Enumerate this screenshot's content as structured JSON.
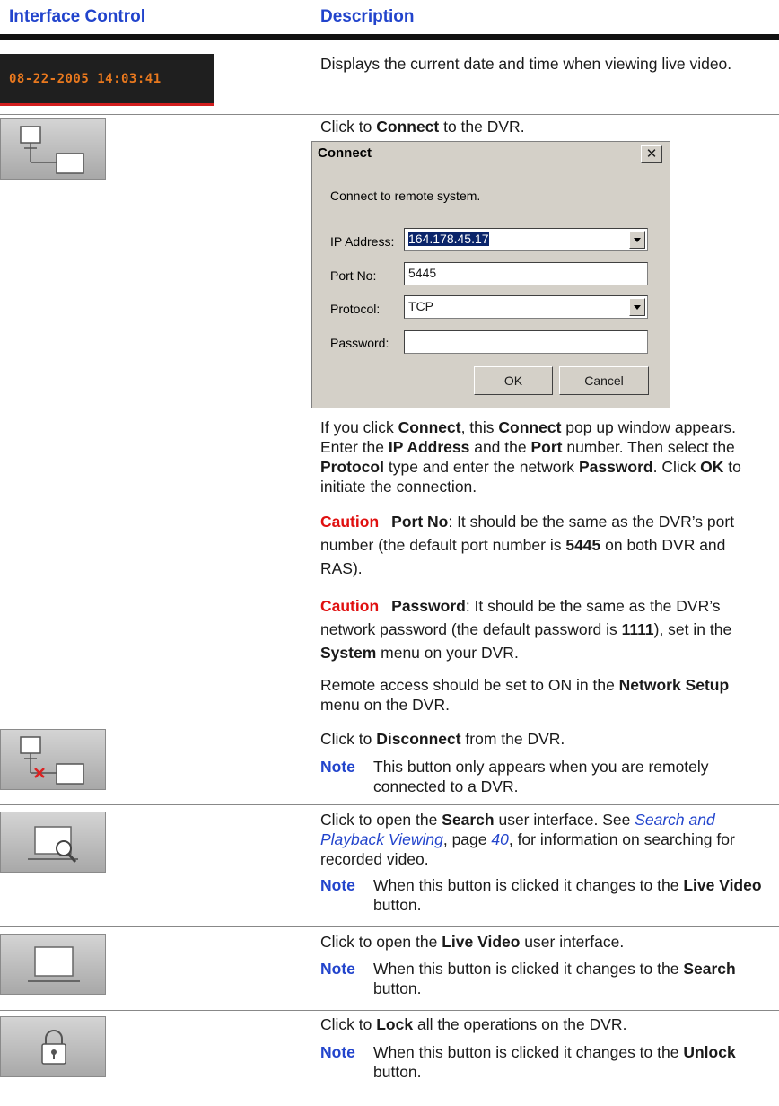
{
  "header": {
    "col_control": "Interface Control",
    "col_description": "Description"
  },
  "row_datetime": {
    "display": "08-22-2005 14:03:41",
    "description": "Displays the current date and time when viewing live video."
  },
  "row_connect": {
    "intro_pre": "Click to ",
    "intro_bold": "Connect",
    "intro_post": " to the DVR.",
    "dialog": {
      "title": "Connect",
      "close": "✕",
      "message": "Connect to remote system.",
      "ip_label": "IP Address:",
      "ip_value": "164.178.45.17",
      "port_label": "Port No:",
      "port_value": "5445",
      "protocol_label": "Protocol:",
      "protocol_value": "TCP",
      "password_label": "Password:",
      "password_value": "",
      "ok": "OK",
      "cancel": "Cancel"
    },
    "para1": {
      "t1": "If you click ",
      "b1": "Connect",
      "t2": ", this ",
      "b2": "Connect",
      "t3": " pop up window appears. Enter the ",
      "b3": "IP Address",
      "t4": " and the ",
      "b4": "Port",
      "t5": " number. Then select the ",
      "b5": "Protocol",
      "t6": " type and enter the network ",
      "b6": "Password",
      "t7": ". Click ",
      "b7": "OK",
      "t8": " to initiate the connection."
    },
    "caution1": {
      "label": "Caution",
      "b1": "Port No",
      "t1": ": It should be the same as the DVR’s port number (the default port number is ",
      "b2": "5445",
      "t2": " on both DVR and RAS)."
    },
    "caution2": {
      "label": "Caution",
      "b1": "Password",
      "t1": ": It should be the same as the DVR’s network password (the default password is ",
      "b2": "1111",
      "t2": "), set in the ",
      "b3": "System",
      "t3": " menu on your DVR."
    },
    "para2": {
      "t1": "Remote access should be set to ON in the ",
      "b1": "Network Setup",
      "t2": " menu on the DVR."
    }
  },
  "row_disconnect": {
    "t1": "Click to ",
    "b1": "Disconnect",
    "t2": " from the DVR.",
    "note_label": "Note",
    "note": "This button only appears when you are remotely connected to a DVR."
  },
  "row_search": {
    "t1": "Click to open the ",
    "b1": "Search",
    "t2": " user interface. See ",
    "link": "Search and Playback Viewing",
    "t3": ", page ",
    "page": "40",
    "t4": ", for information on searching for recorded video.",
    "note_label": "Note",
    "note_t1": "When this button is clicked it changes to the ",
    "note_b1": "Live Video",
    "note_t2": " button."
  },
  "row_live": {
    "t1": "Click to open the ",
    "b1": "Live Video",
    "t2": " user interface.",
    "note_label": "Note",
    "note_t1": "When this button is clicked it changes to the ",
    "note_b1": "Search",
    "note_t2": " button."
  },
  "row_lock": {
    "t1": "Click to ",
    "b1": "Lock",
    "t2": " all the operations on the DVR.",
    "note_label": "Note",
    "note_t1": "When this button is clicked it changes to the ",
    "note_b1": "Unlock",
    "note_t2": " button."
  }
}
